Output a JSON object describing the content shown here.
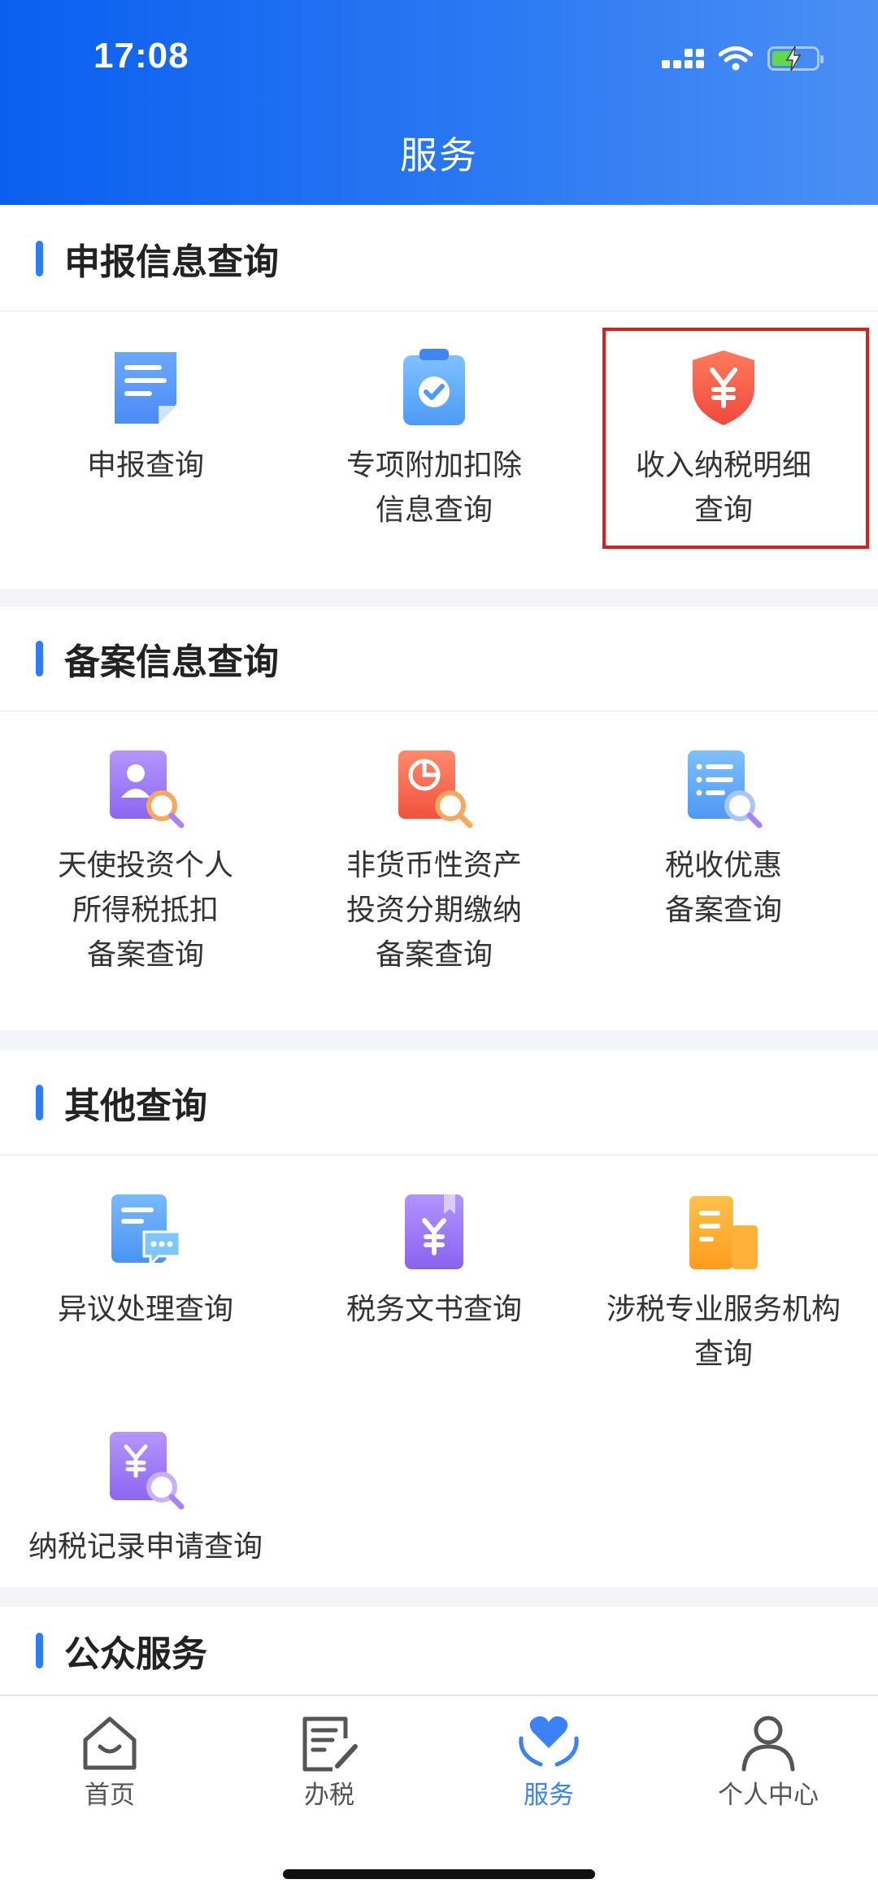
{
  "status_bar": {
    "time": "17:08"
  },
  "header": {
    "title": "服务"
  },
  "sections": [
    {
      "title": "申报信息查询",
      "items": [
        {
          "icon": "document-icon",
          "lines": [
            "申报查询",
            ""
          ]
        },
        {
          "icon": "clipboard-check-icon",
          "lines": [
            "专项附加扣除",
            "信息查询"
          ]
        },
        {
          "icon": "shield-yen-icon",
          "lines": [
            "收入纳税明细",
            "查询"
          ]
        }
      ]
    },
    {
      "title": "备案信息查询",
      "items": [
        {
          "icon": "user-search-icon",
          "lines": [
            "天使投资个人",
            "所得税抵扣",
            "备案查询"
          ]
        },
        {
          "icon": "pie-search-icon",
          "lines": [
            "非货币性资产",
            "投资分期缴纳",
            "备案查询"
          ]
        },
        {
          "icon": "list-search-icon",
          "lines": [
            "税收优惠",
            "备案查询",
            ""
          ]
        }
      ]
    },
    {
      "title": "其他查询",
      "items": [
        {
          "icon": "chat-doc-icon",
          "lines": [
            "异议处理查询",
            ""
          ]
        },
        {
          "icon": "yen-book-icon",
          "lines": [
            "税务文书查询",
            ""
          ]
        },
        {
          "icon": "building-icon",
          "lines": [
            "涉税专业服务机构",
            "查询"
          ]
        },
        {
          "icon": "yen-search-icon",
          "lines": [
            "纳税记录申请查询",
            ""
          ]
        }
      ]
    },
    {
      "title": "公众服务"
    }
  ],
  "tabbar": {
    "tabs": [
      {
        "label": "首页",
        "icon": "home-icon",
        "active": false
      },
      {
        "label": "办税",
        "icon": "edit-doc-icon",
        "active": false
      },
      {
        "label": "服务",
        "icon": "heart-hands-icon",
        "active": true
      },
      {
        "label": "个人中心",
        "icon": "person-icon",
        "active": false
      }
    ]
  },
  "colors": {
    "header_start": "#0a5ff0",
    "header_end": "#4b8ff4",
    "accent": "#2f7cf6",
    "highlight_border": "#e01c1c"
  }
}
